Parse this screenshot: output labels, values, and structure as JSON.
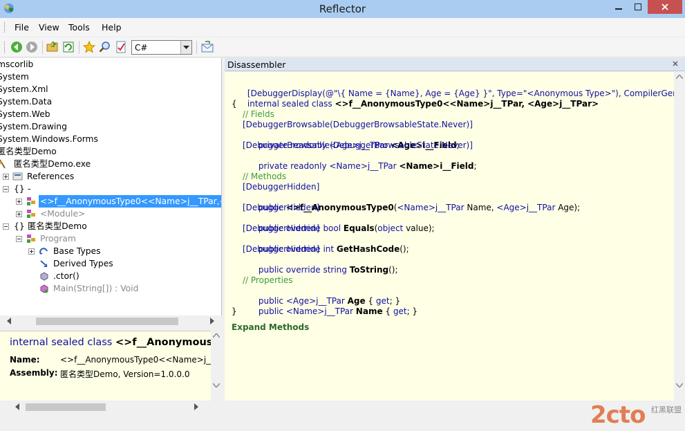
{
  "window": {
    "title": "Reflector"
  },
  "menu": [
    "File",
    "View",
    "Tools",
    "Help"
  ],
  "toolbar": {
    "language": "C#",
    "buttons": [
      "back-icon",
      "forward-icon",
      "open-icon",
      "refresh-icon",
      "bookmark-icon",
      "search-icon",
      "analyze-icon",
      "email-icon"
    ]
  },
  "tree": {
    "rows": [
      {
        "label": "mscorlib"
      },
      {
        "label": "System"
      },
      {
        "label": "System.Xml"
      },
      {
        "label": "System.Data"
      },
      {
        "label": "System.Web"
      },
      {
        "label": "System.Drawing"
      },
      {
        "label": "System.Windows.Forms"
      },
      {
        "label": "匿名类型Demo"
      },
      {
        "label": "匿名类型Demo.exe"
      },
      {
        "label": "References"
      },
      {
        "label": "-"
      },
      {
        "label": "<>f__AnonymousType0<<Name>j__TPar,<Ag"
      },
      {
        "label": "<Module>"
      },
      {
        "label": "匿名类型Demo"
      },
      {
        "label": "Program"
      },
      {
        "label": "Base Types"
      },
      {
        "label": "Derived Types"
      },
      {
        "label": ".ctor()"
      },
      {
        "label": "Main(String[]) : Void"
      }
    ]
  },
  "info": {
    "signature_kw": "internal sealed class",
    "signature_name": "<>f__AnonymousT",
    "name_label": "Name:",
    "name_value": "<>f__AnonymousType0<<Name>j__TI",
    "assembly_label": "Assembly:",
    "assembly_value": "匿名类型Demo, Version=1.0.0.0"
  },
  "disassembler": {
    "title": "Disassembler",
    "expand_methods": "Expand Methods",
    "code": {
      "l1": "[DebuggerDisplay(@\"\\{ Name = {Name}, Age = {Age} }\", Type=\"<Anonymous Type>\"), CompilerGenerated]",
      "l2a": "internal sealed class ",
      "l2b": "<>f__AnonymousType0<<Name>j__TPar, <Age>j__TPar>",
      "l3": "{",
      "c_fields": "// Fields",
      "attr_browsable": "[DebuggerBrowsable(DebuggerBrowsableState.Never)]",
      "f1a": "private readonly ",
      "f1b": "<Age>j__TPar ",
      "f1c": "<Age>i__Field",
      "f1d": ";",
      "f2a": "private readonly ",
      "f2b": "<Name>j__TPar ",
      "f2c": "<Name>i__Field",
      "f2d": ";",
      "c_methods": "// Methods",
      "attr_hidden": "[DebuggerHidden]",
      "m1a": "public ",
      "m1b": "<>f__AnonymousType0",
      "m1c": "(",
      "m1d": "<Name>j__TPar",
      "m1e": " Name, ",
      "m1f": "<Age>j__TPar",
      "m1g": " Age);",
      "m2a": "public override bool ",
      "m2b": "Equals",
      "m2c": "(",
      "m2d": "object",
      "m2e": " value);",
      "m3a": "public override int ",
      "m3b": "GetHashCode",
      "m3c": "();",
      "m4a": "public override string ",
      "m4b": "ToString",
      "m4c": "();",
      "c_props": "// Properties",
      "p1a": "public ",
      "p1b": "<Age>j__TPar ",
      "p1c": "Age",
      "p1d": " { ",
      "p1e": "get",
      "p1f": "; }",
      "p2a": "public ",
      "p2b": "<Name>j__TPar ",
      "p2c": "Name",
      "p2d": " { ",
      "p2e": "get",
      "p2f": "; }",
      "l_end": "}"
    }
  },
  "watermark": {
    "brand": "2cto",
    "sub": "红黑联盟"
  },
  "colors": {
    "selection": "#3399ff",
    "code_bg": "#ffffe6",
    "keyword": "#1010a0",
    "comment": "#3a9a3a"
  }
}
